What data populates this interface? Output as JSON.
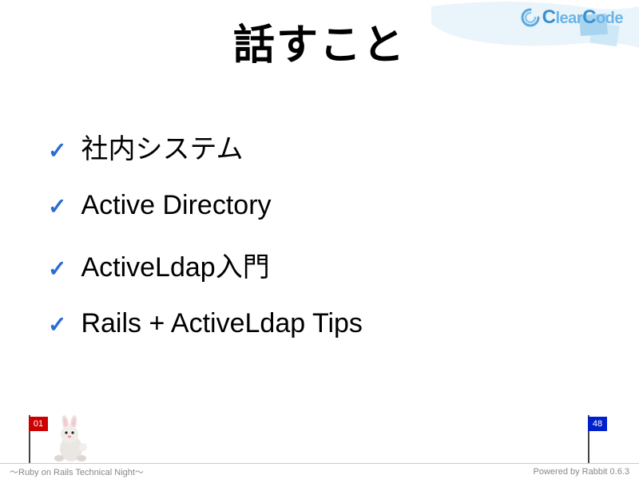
{
  "logo": {
    "text_part1_cap": "C",
    "text_part1_rest": "lear",
    "text_part2_cap": "C",
    "text_part2_rest": "ode"
  },
  "title": "話すこと",
  "bullets": [
    "社内システム",
    "Active Directory",
    "ActiveLdap入門",
    "Rails + ActiveLdap Tips"
  ],
  "progress": {
    "current": "01",
    "total": "48"
  },
  "footer": {
    "left": "〜Ruby on Rails Technical Night〜",
    "right": "Powered by Rabbit 0.6.3"
  }
}
